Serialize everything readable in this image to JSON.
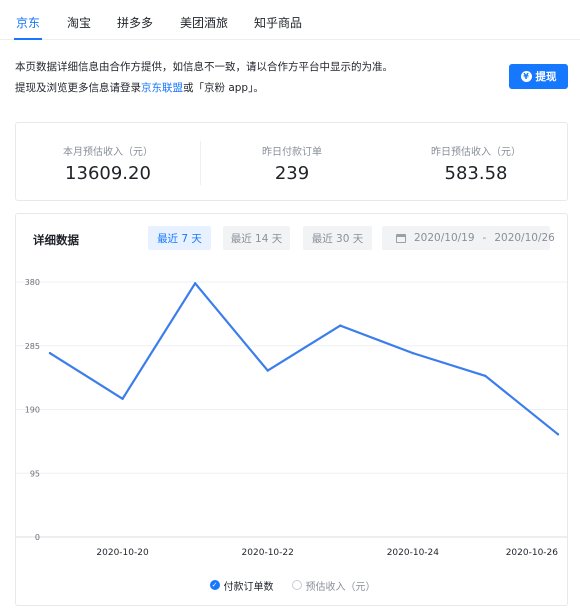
{
  "tabs": [
    {
      "label": "京东",
      "active": true
    },
    {
      "label": "淘宝",
      "active": false
    },
    {
      "label": "拼多多",
      "active": false
    },
    {
      "label": "美团酒旅",
      "active": false
    },
    {
      "label": "知乎商品",
      "active": false
    }
  ],
  "notice": {
    "line1": "本页数据详细信息由合作方提供，如信息不一致，请以合作方平台中显示的为准。",
    "line2_prefix": "提现及浏览更多信息请登录",
    "line2_link": "京东联盟",
    "line2_suffix": "或「京粉 app」。"
  },
  "withdraw_button": {
    "label": "提现",
    "icon": "yen-icon",
    "icon_glyph": "¥"
  },
  "stats": [
    {
      "label": "本月预估收入（元）",
      "value": "13609.20"
    },
    {
      "label": "昨日付款订单",
      "value": "239"
    },
    {
      "label": "昨日预估收入（元）",
      "value": "583.58"
    }
  ],
  "detail": {
    "title": "详细数据",
    "ranges": [
      {
        "label": "最近 7 天",
        "active": true
      },
      {
        "label": "最近 14 天",
        "active": false
      },
      {
        "label": "最近 30 天",
        "active": false
      }
    ],
    "date_range": {
      "start": "2020/10/19",
      "separator": "-",
      "end": "2020/10/26",
      "icon": "calendar-icon"
    }
  },
  "chart_data": {
    "type": "line",
    "x": [
      "2020-10-19",
      "2020-10-20",
      "2020-10-21",
      "2020-10-22",
      "2020-10-23",
      "2020-10-24",
      "2020-10-25",
      "2020-10-26"
    ],
    "x_tick_labels": [
      "2020-10-20",
      "2020-10-22",
      "2020-10-24",
      "2020-10-26"
    ],
    "series": [
      {
        "name": "付款订单数",
        "values": [
          274,
          206,
          378,
          248,
          315,
          274,
          240,
          153
        ],
        "color": "#3b7ded"
      }
    ],
    "y_ticks": [
      0,
      95,
      190,
      285,
      380
    ],
    "ylim": [
      0,
      380
    ],
    "grid": true,
    "legend": [
      {
        "name": "付款订单数",
        "selected": true
      },
      {
        "name": "预估收入（元）",
        "selected": false
      }
    ],
    "legend_position": "bottom"
  },
  "colors": {
    "accent": "#1677ff",
    "line": "#3b7ded"
  }
}
